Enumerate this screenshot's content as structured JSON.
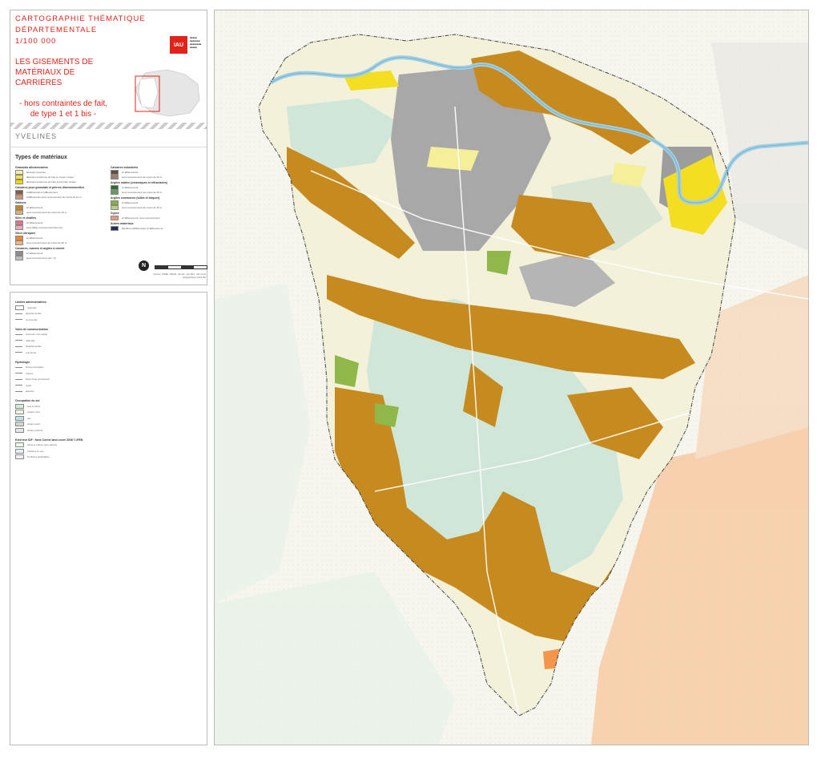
{
  "title_panel": {
    "header_line1": "CARTOGRAPHIE THÉMATIQUE DÉPARTEMENTALE",
    "header_line2": "1/100 000",
    "main_title_line1": "LES GISEMENTS DE",
    "main_title_line2": "MATÉRIAUX DE",
    "main_title_line3": "CARRIÈRES",
    "subtitle_line1": "- hors contraintes de fait,",
    "subtitle_line2": "de type 1 et 1 bis -",
    "logo_text": "IAU",
    "department": "YVELINES"
  },
  "legend_materials": {
    "heading": "Types de matériaux",
    "left_groups": [
      {
        "group": "Granulats alluvionnaires",
        "items": [
          {
            "label": "alluvions récentes",
            "color": "#f5f0a0"
          },
          {
            "label": "alluvions anciennes de bas et moyen niveau",
            "color": "#f2e24a"
          },
          {
            "label": "alluvions anciennes de haut à très haut niveau",
            "color": "#f6d800"
          }
        ]
      },
      {
        "group": "Calcaires pour granulats et pierres dimensionnelles",
        "items": [
          {
            "label": "indifférenciés à l'affleurement",
            "color": "#8b5a3c"
          },
          {
            "label": "indifférenciés sous recouvrement de moins de 10 m",
            "color": "#c89a7a"
          }
        ]
      },
      {
        "group": "Sablons",
        "items": [
          {
            "label": "à l'affleurement",
            "color": "#c8871e"
          },
          {
            "label": "sous recouvrement de moins de 15 m",
            "color": "#deb06a"
          }
        ]
      },
      {
        "group": "Silex et chailles",
        "items": [
          {
            "label": "à l'affleurement",
            "color": "#e86f8c"
          },
          {
            "label": "sous faible recouvrement (limons)",
            "color": "#f0a8b8"
          }
        ]
      },
      {
        "group": "Silice ultrapure",
        "items": [
          {
            "label": "à l'affleurement",
            "color": "#f0852a"
          },
          {
            "label": "sous recouvrement de moins de 20 m",
            "color": "#f6b27a"
          }
        ]
      },
      {
        "group": "Calcaires, marnes et argiles à ciment",
        "items": [
          {
            "label": "à l'affleurement",
            "color": "#8c8c8c"
          },
          {
            "label": "sous recouvrement (alt > 0)",
            "color": "#bdbdbd"
          }
        ]
      }
    ],
    "right_groups": [
      {
        "group": "Calcaires industriels",
        "items": [
          {
            "label": "à l'affleurement",
            "color": "#6b4a3a"
          },
          {
            "label": "sous recouvrement de moins de 15 m",
            "color": "#9a8070"
          }
        ]
      },
      {
        "group": "Argiles nobles (céramiques et réfractaires)",
        "items": [
          {
            "label": "à l'affleurement",
            "color": "#2e6b2e"
          },
          {
            "label": "sous recouvrement de moins de 20 m",
            "color": "#6a9a5a"
          }
        ]
      },
      {
        "group": "Argiles communes (tuiles et briques)",
        "items": [
          {
            "label": "à l'affleurement",
            "color": "#86b040"
          },
          {
            "label": "sous recouvrement de moins de 15 m",
            "color": "#b4d080"
          }
        ]
      },
      {
        "group": "Gypse",
        "items": [
          {
            "label": "à l'affleurement, sous recouvrement",
            "color": "#e89a7a"
          }
        ]
      },
      {
        "group": "Autres matériaux",
        "items": [
          {
            "label": "Meulière indifférenciée à l'affleurement",
            "color": "#2a2a5a"
          }
        ]
      }
    ],
    "north_symbol": "N",
    "source_text": "Sources : DRIEE - BRGM - IAU îdF - juin 2012 ; IGN, fonds topographiques 1/100 000"
  },
  "legend_base": {
    "sections": [
      {
        "heading": "Limites administratives",
        "items": [
          {
            "label": "régionale",
            "kind": "box"
          },
          {
            "label": "départementale",
            "kind": "line"
          },
          {
            "label": "communale",
            "kind": "line"
          }
        ]
      },
      {
        "heading": "Voies de communication",
        "items": [
          {
            "label": "autoroute, voie rapide",
            "kind": "line"
          },
          {
            "label": "nationale",
            "kind": "line"
          },
          {
            "label": "départementale",
            "kind": "line"
          },
          {
            "label": "voie ferrée",
            "kind": "line"
          }
        ]
      },
      {
        "heading": "Hydrologie",
        "items": [
          {
            "label": "fleuves principaux",
            "kind": "line"
          },
          {
            "label": "rivières",
            "kind": "line"
          },
          {
            "label": "plans d'eau permanents",
            "kind": "line"
          },
          {
            "label": "canal",
            "kind": "line"
          },
          {
            "label": "aqueduc",
            "kind": "line"
          }
        ]
      },
      {
        "heading": "Occupation du sol",
        "items": [
          {
            "label": "bois et forêts",
            "kind": "box",
            "color": "#d4eadb"
          },
          {
            "label": "espace rural",
            "kind": "box",
            "color": "#f2f2df"
          },
          {
            "label": "eau",
            "kind": "box",
            "color": "#bfe3f0"
          },
          {
            "label": "urbain ouvert",
            "kind": "box",
            "color": "#cfd8c8"
          },
          {
            "label": "urbain construit",
            "kind": "box",
            "color": "#e6e6e6"
          }
        ]
      },
      {
        "heading": "Extérieur IDF : fond Corine land cover 2006 ©-IFEN",
        "items": [
          {
            "label": "forêts et milieux semi-naturels",
            "kind": "box",
            "color": "#eef6ee"
          },
          {
            "label": "Surfaces en eau",
            "kind": "box",
            "color": "#dff0f7"
          },
          {
            "label": "Territoires artificialisés",
            "kind": "box",
            "color": "#f0f0f0"
          }
        ]
      }
    ]
  },
  "map": {
    "colors": {
      "forest": "#cfe6d8",
      "rural": "#f4f1db",
      "sablons": "#c68a1f",
      "calcaire_ciment": "#9d9d9d",
      "alluvions": "#f4de21",
      "argile": "#8fb74a",
      "river": "#9fd0e6",
      "outside": "#fafaf6",
      "silice": "#f3954a"
    }
  }
}
